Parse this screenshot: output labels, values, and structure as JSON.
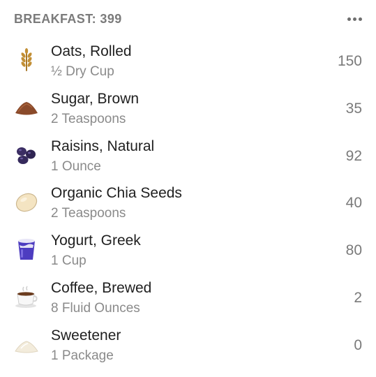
{
  "header": {
    "title": "BREAKFAST: 399",
    "more_icon": "more-horizontal-icon"
  },
  "items": [
    {
      "name": "Oats, Rolled",
      "serving": "½ Dry Cup",
      "calories": "150",
      "icon": "wheat-icon"
    },
    {
      "name": "Sugar, Brown",
      "serving": "2 Teaspoons",
      "calories": "35",
      "icon": "brown-sugar-pile-icon"
    },
    {
      "name": "Raisins, Natural",
      "serving": "1 Ounce",
      "calories": "92",
      "icon": "raisins-icon"
    },
    {
      "name": "Organic Chia Seeds",
      "serving": "2 Teaspoons",
      "calories": "40",
      "icon": "seed-icon"
    },
    {
      "name": "Yogurt, Greek",
      "serving": "1 Cup",
      "calories": "80",
      "icon": "yogurt-cup-icon"
    },
    {
      "name": "Coffee, Brewed",
      "serving": "8 Fluid Ounces",
      "calories": "2",
      "icon": "coffee-cup-icon"
    },
    {
      "name": "Sweetener",
      "serving": "1 Package",
      "calories": "0",
      "icon": "sweetener-pile-icon"
    }
  ],
  "colors": {
    "header_text": "#7b7b7b",
    "name_text": "#1f1f1f",
    "serving_text": "#8a8a8a",
    "calories_text": "#7a7a7a"
  }
}
